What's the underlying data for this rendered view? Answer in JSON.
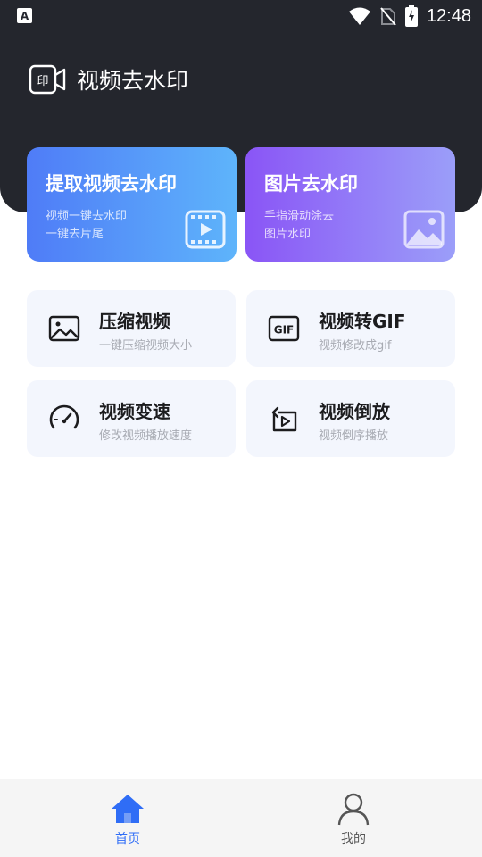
{
  "status_bar": {
    "notification_badge": "A",
    "time": "12:48"
  },
  "header": {
    "title": "视频去水印",
    "background_color": "#24262d"
  },
  "feature_cards": [
    {
      "title": "提取视频去水印",
      "lines": [
        "视频一键去水印",
        "一键去片尾"
      ],
      "icon": "film-play-icon",
      "gradient": [
        "#4f7cf7",
        "#5eb4fb"
      ]
    },
    {
      "title": "图片去水印",
      "lines": [
        "手指滑动涂去",
        "图片水印"
      ],
      "icon": "image-icon",
      "gradient": [
        "#8a55f6",
        "#9b9ef9"
      ]
    }
  ],
  "tools": [
    {
      "title": "压缩视频",
      "subtitle": "一键压缩视频大小",
      "icon": "image-compress-icon"
    },
    {
      "title": "视频转GIF",
      "subtitle": "视频修改成gif",
      "icon": "gif-icon",
      "icon_text": "GIF"
    },
    {
      "title": "视频变速",
      "subtitle": "修改视频播放速度",
      "icon": "speedometer-icon"
    },
    {
      "title": "视频倒放",
      "subtitle": "视频倒序播放",
      "icon": "reverse-play-icon"
    }
  ],
  "bottom_nav": {
    "items": [
      {
        "label": "首页",
        "icon": "home-icon",
        "active": true
      },
      {
        "label": "我的",
        "icon": "user-icon",
        "active": false
      }
    ],
    "active_color": "#2f6df6",
    "inactive_color": "#555555"
  }
}
